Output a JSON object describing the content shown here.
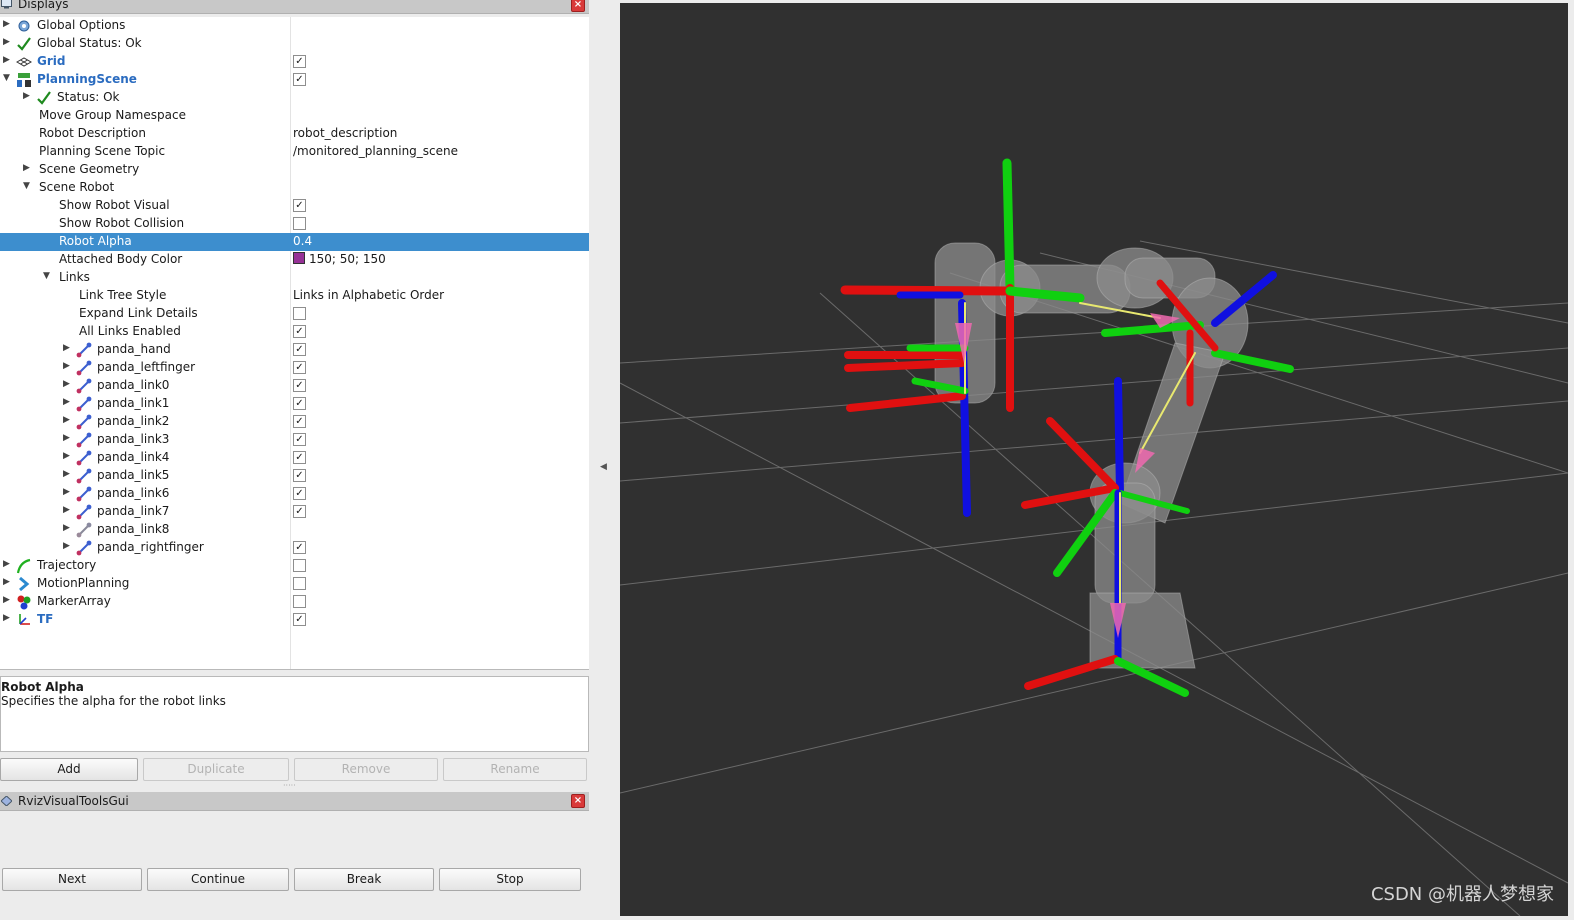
{
  "displays_panel": {
    "title": "Displays",
    "rows": [
      {
        "label": "Global Options",
        "value": "",
        "check": null,
        "indent": 0,
        "icon": "gear-icon",
        "arrow": "right",
        "style": ""
      },
      {
        "label": "Global Status: Ok",
        "value": "",
        "check": null,
        "indent": 0,
        "icon": "check-icon",
        "arrow": "right",
        "style": ""
      },
      {
        "label": "Grid",
        "value": "",
        "check": true,
        "indent": 0,
        "icon": "grid-icon",
        "arrow": "right",
        "style": "bluebold"
      },
      {
        "label": "PlanningScene",
        "value": "",
        "check": true,
        "indent": 0,
        "icon": "planning-scene-icon",
        "arrow": "down",
        "style": "bluebold"
      },
      {
        "label": "Status: Ok",
        "value": "",
        "check": null,
        "indent": 1,
        "icon": "check-icon",
        "arrow": "right",
        "style": ""
      },
      {
        "label": "Move Group Namespace",
        "value": "",
        "check": null,
        "indent": 1,
        "icon": "",
        "arrow": "",
        "style": ""
      },
      {
        "label": "Robot Description",
        "value": "robot_description",
        "check": null,
        "indent": 1,
        "icon": "",
        "arrow": "",
        "style": ""
      },
      {
        "label": "Planning Scene Topic",
        "value": "/monitored_planning_scene",
        "check": null,
        "indent": 1,
        "icon": "",
        "arrow": "",
        "style": ""
      },
      {
        "label": "Scene Geometry",
        "value": "",
        "check": null,
        "indent": 1,
        "icon": "",
        "arrow": "right",
        "style": ""
      },
      {
        "label": "Scene Robot",
        "value": "",
        "check": null,
        "indent": 1,
        "icon": "",
        "arrow": "down",
        "style": ""
      },
      {
        "label": "Show Robot Visual",
        "value": "",
        "check": true,
        "indent": 2,
        "icon": "",
        "arrow": "",
        "style": ""
      },
      {
        "label": "Show Robot Collision",
        "value": "",
        "check": false,
        "indent": 2,
        "icon": "",
        "arrow": "",
        "style": ""
      },
      {
        "label": "Robot Alpha",
        "value": "0.4",
        "check": null,
        "indent": 2,
        "icon": "",
        "arrow": "",
        "style": "",
        "selected": true
      },
      {
        "label": "Attached Body Color",
        "value": "150; 50; 150",
        "check": null,
        "indent": 2,
        "icon": "",
        "arrow": "",
        "style": "",
        "swatch": "#963296"
      },
      {
        "label": "Links",
        "value": "",
        "check": null,
        "indent": 2,
        "icon": "",
        "arrow": "down",
        "style": ""
      },
      {
        "label": "Link Tree Style",
        "value": "Links in Alphabetic Order",
        "check": null,
        "indent": 3,
        "icon": "",
        "arrow": "",
        "style": ""
      },
      {
        "label": "Expand Link Details",
        "value": "",
        "check": false,
        "indent": 3,
        "icon": "",
        "arrow": "",
        "style": ""
      },
      {
        "label": "All Links Enabled",
        "value": "",
        "check": true,
        "indent": 3,
        "icon": "",
        "arrow": "",
        "style": ""
      },
      {
        "label": "panda_hand",
        "value": "",
        "check": true,
        "indent": 3,
        "icon": "link-icon",
        "arrow": "right",
        "style": ""
      },
      {
        "label": "panda_leftfinger",
        "value": "",
        "check": true,
        "indent": 3,
        "icon": "link-icon",
        "arrow": "right",
        "style": ""
      },
      {
        "label": "panda_link0",
        "value": "",
        "check": true,
        "indent": 3,
        "icon": "link-icon",
        "arrow": "right",
        "style": ""
      },
      {
        "label": "panda_link1",
        "value": "",
        "check": true,
        "indent": 3,
        "icon": "link-icon",
        "arrow": "right",
        "style": ""
      },
      {
        "label": "panda_link2",
        "value": "",
        "check": true,
        "indent": 3,
        "icon": "link-icon",
        "arrow": "right",
        "style": ""
      },
      {
        "label": "panda_link3",
        "value": "",
        "check": true,
        "indent": 3,
        "icon": "link-icon",
        "arrow": "right",
        "style": ""
      },
      {
        "label": "panda_link4",
        "value": "",
        "check": true,
        "indent": 3,
        "icon": "link-icon",
        "arrow": "right",
        "style": ""
      },
      {
        "label": "panda_link5",
        "value": "",
        "check": true,
        "indent": 3,
        "icon": "link-icon",
        "arrow": "right",
        "style": ""
      },
      {
        "label": "panda_link6",
        "value": "",
        "check": true,
        "indent": 3,
        "icon": "link-icon",
        "arrow": "right",
        "style": ""
      },
      {
        "label": "panda_link7",
        "value": "",
        "check": true,
        "indent": 3,
        "icon": "link-icon",
        "arrow": "right",
        "style": ""
      },
      {
        "label": "panda_link8",
        "value": "",
        "check": null,
        "indent": 3,
        "icon": "link-icon-gray",
        "arrow": "right",
        "style": ""
      },
      {
        "label": "panda_rightfinger",
        "value": "",
        "check": true,
        "indent": 3,
        "icon": "link-icon",
        "arrow": "right",
        "style": ""
      },
      {
        "label": "Trajectory",
        "value": "",
        "check": false,
        "indent": 0,
        "icon": "trajectory-icon",
        "arrow": "right",
        "style": ""
      },
      {
        "label": "MotionPlanning",
        "value": "",
        "check": false,
        "indent": 0,
        "icon": "motion-planning-icon",
        "arrow": "right",
        "style": ""
      },
      {
        "label": "MarkerArray",
        "value": "",
        "check": false,
        "indent": 0,
        "icon": "marker-array-icon",
        "arrow": "right",
        "style": ""
      },
      {
        "label": "TF",
        "value": "",
        "check": true,
        "indent": 0,
        "icon": "tf-icon",
        "arrow": "right",
        "style": "bluebold"
      }
    ]
  },
  "description": {
    "title": "Robot Alpha",
    "text": "Specifies the alpha for the robot links"
  },
  "display_buttons": {
    "add": "Add",
    "duplicate": "Duplicate",
    "remove": "Remove",
    "rename": "Rename"
  },
  "tools_panel": {
    "title": "RvizVisualToolsGui",
    "next": "Next",
    "continue": "Continue",
    "break": "Break",
    "stop": "Stop"
  },
  "watermark": "CSDN @机器人梦想家",
  "colors": {
    "selection": "#3d8ece",
    "viewport_bg": "#303030",
    "axis_x": "#e01010",
    "axis_y": "#10d010",
    "axis_z": "#1010e0"
  }
}
